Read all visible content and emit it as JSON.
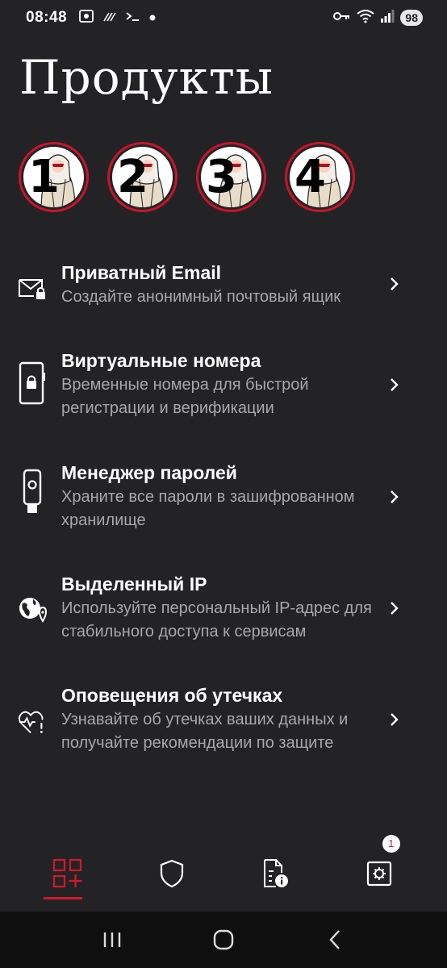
{
  "status_bar": {
    "time": "08:48",
    "left_icons": [
      "screenshot-icon",
      "fingerprint-icon",
      "terminal-icon",
      "dot-icon"
    ],
    "right_icons": [
      "key-icon",
      "wifi-icon",
      "signal-icon"
    ],
    "battery": "98"
  },
  "page": {
    "title": "Продукты"
  },
  "stories": [
    {
      "number": "1"
    },
    {
      "number": "2"
    },
    {
      "number": "3"
    },
    {
      "number": "4"
    }
  ],
  "products": [
    {
      "title": "Приватный Email",
      "description": "Создайте анонимный почтовый ящик",
      "icon": "mail-lock-icon"
    },
    {
      "title": "Виртуальные номера",
      "description": "Временные номера для быстрой регистрации и верификации",
      "icon": "phone-lock-icon"
    },
    {
      "title": "Менеджер паролей",
      "description": "Храните все пароли в зашифрованном хранилище",
      "icon": "usb-key-icon"
    },
    {
      "title": "Выделенный IP",
      "description": "Используйте персональный IP-адрес для стабильного доступа к сервисам",
      "icon": "globe-location-icon"
    },
    {
      "title": "Оповещения об утечках",
      "description": "Узнавайте об утечках ваших данных и получайте рекомендации по защите",
      "icon": "heart-alert-icon"
    }
  ],
  "bottom_nav": {
    "items": [
      "products-tab",
      "shield-tab",
      "document-info-tab",
      "settings-tab"
    ],
    "settings_badge": "1"
  },
  "colors": {
    "background": "#232326",
    "accent": "#d11a2a",
    "muted_text": "#a8a8ab"
  }
}
